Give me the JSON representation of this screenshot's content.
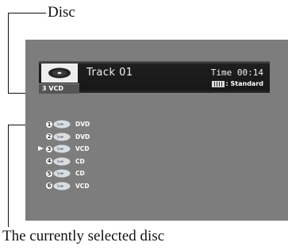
{
  "callouts": {
    "top": "Disc",
    "bottom": "The currently selected disc"
  },
  "header": {
    "track": "Track 01",
    "time": "Time  00:14",
    "mode": ": Standard",
    "current_disc": "3 VCD"
  },
  "discs": [
    {
      "number": "1",
      "type": "DVD",
      "selected": false
    },
    {
      "number": "2",
      "type": "DVD",
      "selected": false
    },
    {
      "number": "3",
      "type": "VCD",
      "selected": true
    },
    {
      "number": "4",
      "type": "CD",
      "selected": false
    },
    {
      "number": "5",
      "type": "CD",
      "selected": false
    },
    {
      "number": "6",
      "type": "VCD",
      "selected": false
    }
  ],
  "colors": {
    "screen_bg": "#7d7d7d",
    "header_bg": "#1a1a1a",
    "text": "#ffffff"
  },
  "icons": {
    "current_disc": "disc-icon",
    "disc_slot": "disc-icon",
    "mode": "standard-mode-icon",
    "selection": "arrow-right-icon"
  }
}
